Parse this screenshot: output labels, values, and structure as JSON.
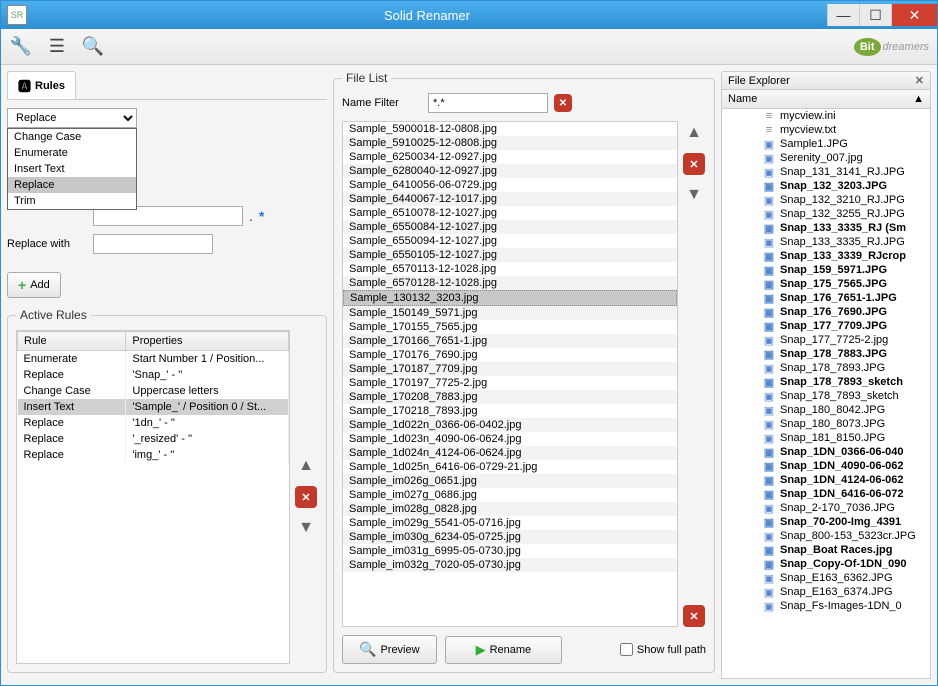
{
  "window": {
    "title": "Solid Renamer"
  },
  "brand": {
    "bit": "Bit",
    "rest": "dreamers"
  },
  "tabs": {
    "rules": "Rules"
  },
  "rule_form": {
    "select_label": "Replace",
    "options": [
      "Change Case",
      "Enumerate",
      "Insert Text",
      "Replace",
      "Trim"
    ],
    "selected_option": "Replace",
    "replace_with_label": "Replace with",
    "add_label": "Add"
  },
  "active_rules": {
    "legend": "Active Rules",
    "headers": [
      "Rule",
      "Properties"
    ],
    "rows": [
      {
        "rule": "Enumerate",
        "props": "Start Number 1 / Position..."
      },
      {
        "rule": "Replace",
        "props": "'Snap_' - ''"
      },
      {
        "rule": "Change Case",
        "props": "Uppercase letters"
      },
      {
        "rule": "Insert Text",
        "props": "'Sample_' / Position 0 / St...",
        "sel": true
      },
      {
        "rule": "Replace",
        "props": "'1dn_' - ''"
      },
      {
        "rule": "Replace",
        "props": "'_resized' - ''"
      },
      {
        "rule": "Replace",
        "props": "'img_' - ''"
      }
    ]
  },
  "filelist": {
    "legend": "File List",
    "filter_label": "Name Filter",
    "filter_value": "*.*",
    "preview": "Preview",
    "rename": "Rename",
    "show_full_path": "Show full path",
    "files": [
      "Sample_5900018-12-0808.jpg",
      "Sample_5910025-12-0808.jpg",
      "Sample_6250034-12-0927.jpg",
      "Sample_6280040-12-0927.jpg",
      "Sample_6410056-06-0729.jpg",
      "Sample_6440067-12-1017.jpg",
      "Sample_6510078-12-1027.jpg",
      "Sample_6550084-12-1027.jpg",
      "Sample_6550094-12-1027.jpg",
      "Sample_6550105-12-1027.jpg",
      "Sample_6570113-12-1028.jpg",
      "Sample_6570128-12-1028.jpg",
      "Sample_130132_3203.jpg",
      "Sample_150149_5971.jpg",
      "Sample_170155_7565.jpg",
      "Sample_170166_7651-1.jpg",
      "Sample_170176_7690.jpg",
      "Sample_170187_7709.jpg",
      "Sample_170197_7725-2.jpg",
      "Sample_170208_7883.jpg",
      "Sample_170218_7893.jpg",
      "Sample_1d022n_0366-06-0402.jpg",
      "Sample_1d023n_4090-06-0624.jpg",
      "Sample_1d024n_4124-06-0624.jpg",
      "Sample_1d025n_6416-06-0729-21.jpg",
      "Sample_im026g_0651.jpg",
      "Sample_im027g_0686.jpg",
      "Sample_im028g_0828.jpg",
      "Sample_im029g_5541-05-0716.jpg",
      "Sample_im030g_6234-05-0725.jpg",
      "Sample_im031g_6995-05-0730.jpg",
      "Sample_im032g_7020-05-0730.jpg"
    ],
    "selected_index": 12
  },
  "explorer": {
    "title": "File Explorer",
    "col": "Name",
    "items": [
      {
        "name": "mycview.ini",
        "icon": "ini"
      },
      {
        "name": "mycview.txt",
        "icon": "ini"
      },
      {
        "name": "Sample1.JPG",
        "icon": "img"
      },
      {
        "name": "Serenity_007.jpg",
        "icon": "img"
      },
      {
        "name": "Snap_131_3141_RJ.JPG",
        "icon": "img"
      },
      {
        "name": "Snap_132_3203.JPG",
        "icon": "img",
        "bold": true
      },
      {
        "name": "Snap_132_3210_RJ.JPG",
        "icon": "img"
      },
      {
        "name": "Snap_132_3255_RJ.JPG",
        "icon": "img"
      },
      {
        "name": "Snap_133_3335_RJ (Sm",
        "icon": "img",
        "bold": true
      },
      {
        "name": "Snap_133_3335_RJ.JPG",
        "icon": "img"
      },
      {
        "name": "Snap_133_3339_RJcrop",
        "icon": "img",
        "bold": true
      },
      {
        "name": "Snap_159_5971.JPG",
        "icon": "img",
        "bold": true
      },
      {
        "name": "Snap_175_7565.JPG",
        "icon": "img",
        "bold": true
      },
      {
        "name": "Snap_176_7651-1.JPG",
        "icon": "img",
        "bold": true
      },
      {
        "name": "Snap_176_7690.JPG",
        "icon": "img",
        "bold": true
      },
      {
        "name": "Snap_177_7709.JPG",
        "icon": "img",
        "bold": true
      },
      {
        "name": "Snap_177_7725-2.jpg",
        "icon": "img"
      },
      {
        "name": "Snap_178_7883.JPG",
        "icon": "img",
        "bold": true
      },
      {
        "name": "Snap_178_7893.JPG",
        "icon": "img"
      },
      {
        "name": "Snap_178_7893_sketch",
        "icon": "img",
        "bold": true
      },
      {
        "name": "Snap_178_7893_sketch",
        "icon": "img"
      },
      {
        "name": "Snap_180_8042.JPG",
        "icon": "img"
      },
      {
        "name": "Snap_180_8073.JPG",
        "icon": "img"
      },
      {
        "name": "Snap_181_8150.JPG",
        "icon": "img"
      },
      {
        "name": "Snap_1DN_0366-06-040",
        "icon": "img",
        "bold": true
      },
      {
        "name": "Snap_1DN_4090-06-062",
        "icon": "img",
        "bold": true
      },
      {
        "name": "Snap_1DN_4124-06-062",
        "icon": "img",
        "bold": true
      },
      {
        "name": "Snap_1DN_6416-06-072",
        "icon": "img",
        "bold": true
      },
      {
        "name": "Snap_2-170_7036.JPG",
        "icon": "img"
      },
      {
        "name": "Snap_70-200-Img_4391",
        "icon": "img",
        "bold": true
      },
      {
        "name": "Snap_800-153_5323cr.JPG",
        "icon": "img"
      },
      {
        "name": "Snap_Boat Races.jpg",
        "icon": "img",
        "bold": true
      },
      {
        "name": "Snap_Copy-Of-1DN_090",
        "icon": "img",
        "bold": true
      },
      {
        "name": "Snap_E163_6362.JPG",
        "icon": "img"
      },
      {
        "name": "Snap_E163_6374.JPG",
        "icon": "img"
      },
      {
        "name": "Snap_Fs-Images-1DN_0",
        "icon": "img"
      }
    ]
  }
}
